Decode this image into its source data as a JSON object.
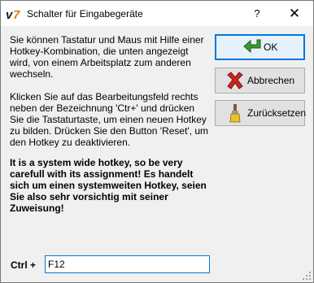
{
  "window": {
    "title": "Schalter für Eingabegeräte",
    "help_label": "?",
    "close_label": "✕"
  },
  "icons": {
    "app": "v7-app-icon",
    "ok": "green-arrow-icon",
    "cancel": "red-x-icon",
    "reset": "brush-icon",
    "grip": "resize-grip-icon"
  },
  "content": {
    "paragraph1": "Sie können Tastatur und Maus mit Hilfe einer Hotkey-Kombination, die unten angezeigt wird, von einem Arbeitsplatz zum anderen wechseln.",
    "paragraph2": "Klicken Sie auf das Bearbeitungsfeld rechts neben der Bezeichnung 'Ctr+' und drücken Sie die Tastaturtaste, um einen neuen Hotkey zu bilden. Drücken Sie den Button 'Reset', um den Hotkey zu deaktivieren.",
    "warning": "It is a system wide hotkey, so be very carefull with its assignment! Es handelt sich um einen systemweiten Hotkey, seien Sie also sehr vorsichtig mit seiner Zuweisung!"
  },
  "buttons": {
    "ok": "OK",
    "cancel": "Abbrechen",
    "reset": "Zurücksetzen"
  },
  "hotkey": {
    "label": "Ctrl +",
    "value": "F12"
  },
  "colors": {
    "accent": "#0078d7",
    "dialog_bg": "#f0f0f0",
    "button_bg": "#e1e1e1"
  }
}
